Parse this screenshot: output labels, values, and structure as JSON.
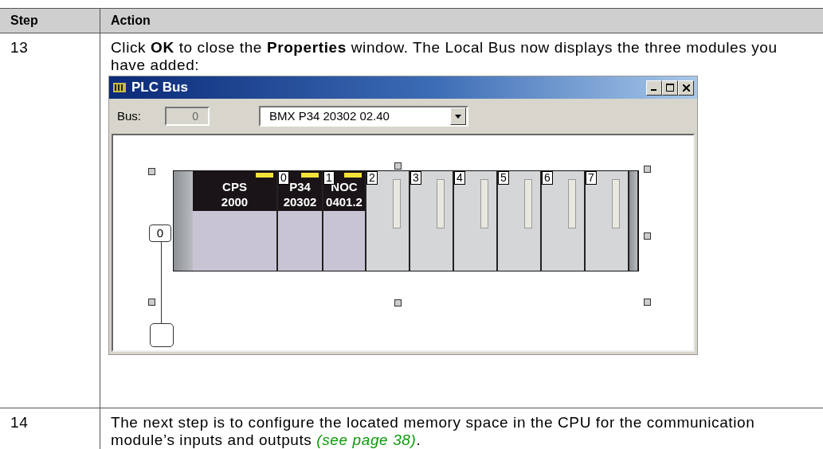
{
  "table": {
    "columns": [
      "Step",
      "Action"
    ],
    "rows": [
      {
        "step": "13",
        "text": "Click **OK** to close the **Properties** window. The Local Bus now displays the three modules you have added:",
        "screenshot": {
          "title": "PLC Bus",
          "bus_label": "Bus:",
          "bus_value": "0",
          "module_select": "BMX P34 20302 02.40",
          "rack_node": "0",
          "modules": [
            {
              "kind": "power",
              "lines": [
                "CPS",
                "2000"
              ]
            },
            {
              "kind": "cpu",
              "slot": "0",
              "lines": [
                "P34",
                "20302"
              ]
            },
            {
              "kind": "comm",
              "slot": "1",
              "lines": [
                "NOC",
                "0401.2"
              ]
            },
            {
              "kind": "empty",
              "slot": "2"
            },
            {
              "kind": "empty",
              "slot": "3"
            },
            {
              "kind": "empty",
              "slot": "4"
            },
            {
              "kind": "empty",
              "slot": "5"
            },
            {
              "kind": "empty",
              "slot": "6"
            },
            {
              "kind": "empty",
              "slot": "7"
            }
          ]
        }
      },
      {
        "step": "14",
        "text": "The next step is to configure the located memory space in the CPU for the communication module’s inputs and outputs ",
        "link": "(see page 38)",
        "text_after": "."
      }
    ]
  }
}
